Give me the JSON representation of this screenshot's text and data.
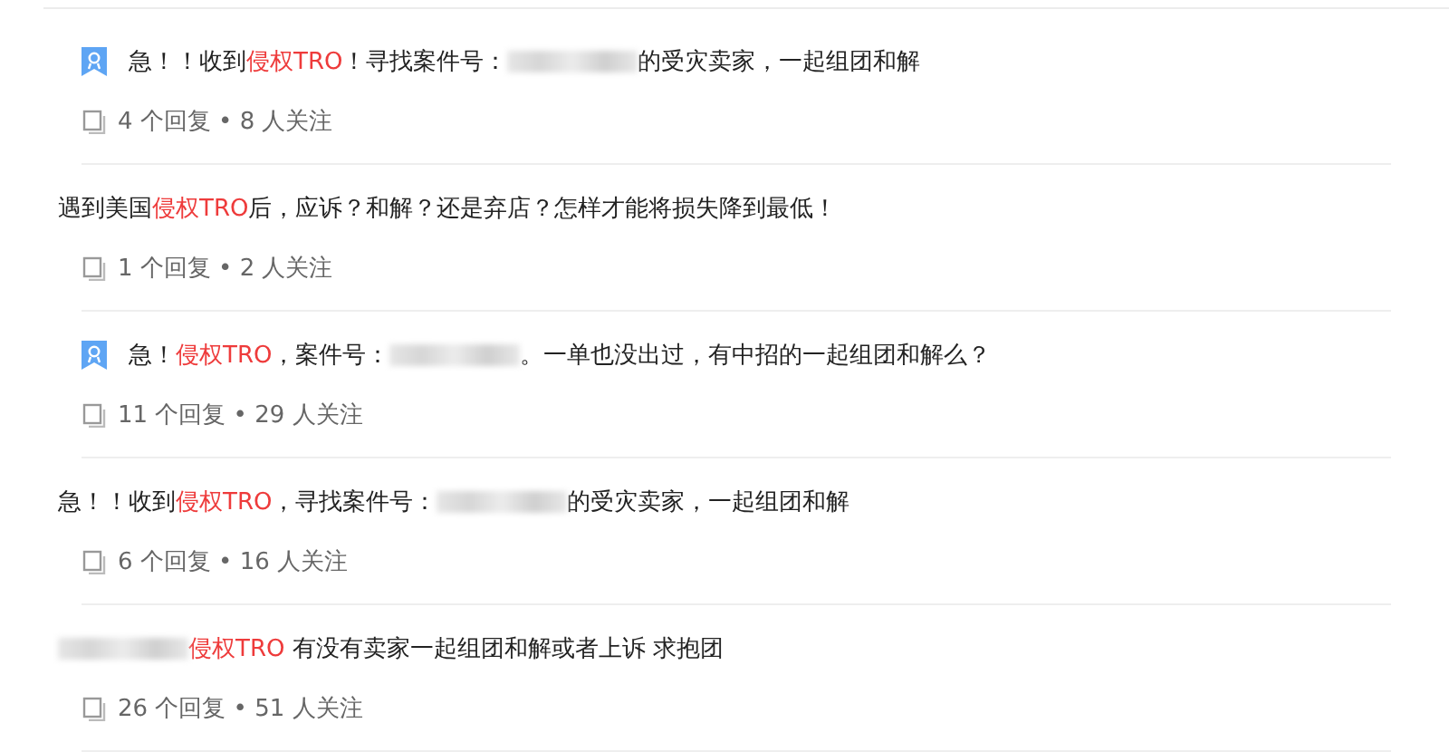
{
  "topics": [
    {
      "featured": true,
      "title": [
        {
          "kind": "text",
          "text": "急！！收到"
        },
        {
          "kind": "highlight",
          "text": "侵权TRO"
        },
        {
          "kind": "text",
          "text": "！寻找案件号："
        },
        {
          "kind": "redacted"
        },
        {
          "kind": "text",
          "text": "的受灾卖家，一起组团和解"
        }
      ],
      "meta": "4 个回复 • 8 人关注"
    },
    {
      "featured": false,
      "title": [
        {
          "kind": "text",
          "text": "遇到美国"
        },
        {
          "kind": "highlight",
          "text": "侵权TRO"
        },
        {
          "kind": "text",
          "text": "后，应诉？和解？还是弃店？怎样才能将损失降到最低！"
        }
      ],
      "meta": "1 个回复 • 2 人关注"
    },
    {
      "featured": true,
      "title": [
        {
          "kind": "text",
          "text": "急！"
        },
        {
          "kind": "highlight",
          "text": "侵权TRO"
        },
        {
          "kind": "text",
          "text": "，案件号："
        },
        {
          "kind": "redacted"
        },
        {
          "kind": "text",
          "text": "。一单也没出过，有中招的一起组团和解么？"
        }
      ],
      "meta": "11 个回复 • 29 人关注"
    },
    {
      "featured": false,
      "title": [
        {
          "kind": "text",
          "text": "急！！收到"
        },
        {
          "kind": "highlight",
          "text": "侵权TRO"
        },
        {
          "kind": "text",
          "text": "，寻找案件号："
        },
        {
          "kind": "redacted"
        },
        {
          "kind": "text",
          "text": "的受灾卖家，一起组团和解"
        }
      ],
      "meta": "6 个回复 • 16 人关注"
    },
    {
      "featured": false,
      "title": [
        {
          "kind": "redacted"
        },
        {
          "kind": "highlight",
          "text": "侵权TRO"
        },
        {
          "kind": "text",
          "text": " 有没有卖家一起组团和解或者上诉 求抱团"
        }
      ],
      "meta": "26 个回复 • 51 人关注"
    }
  ]
}
